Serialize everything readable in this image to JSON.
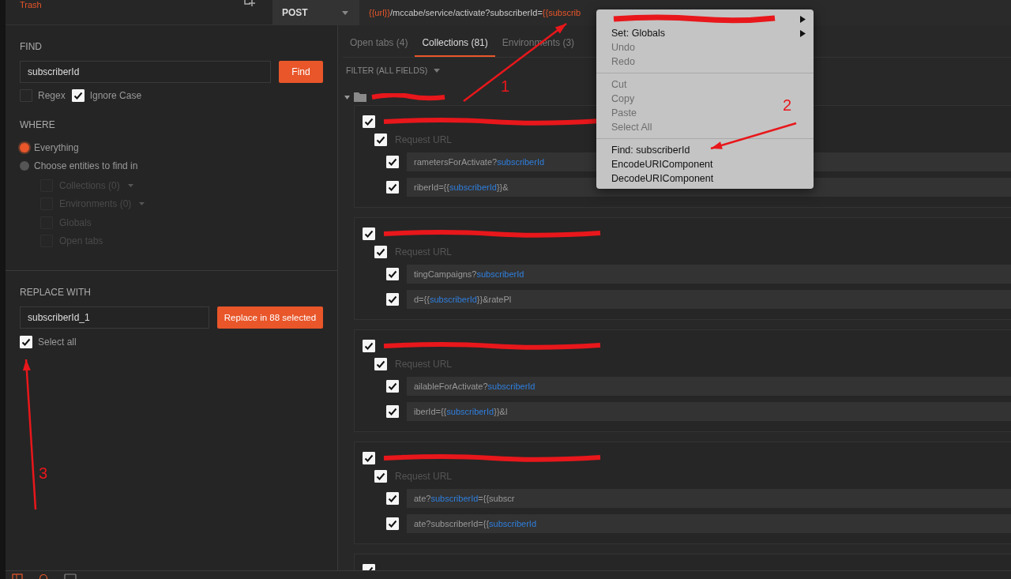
{
  "sidebar": {
    "title": "Trash"
  },
  "request": {
    "method": "POST",
    "url_parts": [
      {
        "text": "{{url}}",
        "variable": true
      },
      {
        "text": "/mccabe/service/activate?subscriberId=",
        "variable": false
      },
      {
        "text": "{{subscrib",
        "variable": true
      }
    ]
  },
  "find_panel": {
    "find_label": "FIND",
    "find_value": "subscriberId",
    "find_button": "Find",
    "options": [
      {
        "label": "Regex",
        "checked": false
      },
      {
        "label": "Ignore Case",
        "checked": true
      }
    ],
    "where_label": "WHERE",
    "scopes": [
      {
        "label": "Everything",
        "selected": true
      },
      {
        "label": "Choose entities to find in",
        "selected": false
      }
    ],
    "entities": [
      {
        "label": "Collections (0)",
        "checked": false,
        "dropdown": true
      },
      {
        "label": "Environments (0)",
        "checked": false,
        "dropdown": true
      },
      {
        "label": "Globals",
        "checked": false,
        "dropdown": false
      },
      {
        "label": "Open tabs",
        "checked": false,
        "dropdown": false
      }
    ],
    "replace_label": "REPLACE WITH",
    "replace_value": "subscriberId_1",
    "replace_button": "Replace in 88 selected",
    "select_all": {
      "label": "Select all",
      "checked": true
    }
  },
  "tabs": [
    {
      "label": "Open tabs (4)",
      "selected": false
    },
    {
      "label": "Collections (81)",
      "selected": true
    },
    {
      "label": "Environments (3)",
      "selected": false
    }
  ],
  "filter": {
    "label": "FILTER (ALL FIELDS)"
  },
  "results": [
    {
      "checked": true,
      "section": "Request URL",
      "section_checked": true,
      "urls": [
        {
          "checked": true,
          "parts": [
            {
              "text": "rametersForActivate?",
              "match": false
            },
            {
              "text": "subscriberId",
              "match": true
            }
          ]
        },
        {
          "checked": true,
          "parts": [
            {
              "text": "riberId={{",
              "match": false
            },
            {
              "text": "subscriberId",
              "match": true
            },
            {
              "text": "}}&",
              "match": false
            }
          ]
        }
      ]
    },
    {
      "checked": true,
      "section": "Request URL",
      "section_checked": true,
      "urls": [
        {
          "checked": true,
          "parts": [
            {
              "text": "tingCampaigns?",
              "match": false
            },
            {
              "text": "subscriberId",
              "match": true
            }
          ]
        },
        {
          "checked": true,
          "parts": [
            {
              "text": "d={{",
              "match": false
            },
            {
              "text": "subscriberId",
              "match": true
            },
            {
              "text": "}}&ratePl",
              "match": false
            }
          ]
        }
      ]
    },
    {
      "checked": true,
      "section": "Request URL",
      "section_checked": true,
      "urls": [
        {
          "checked": true,
          "parts": [
            {
              "text": "ailableForActivate?",
              "match": false
            },
            {
              "text": "subscriberId",
              "match": true
            }
          ]
        },
        {
          "checked": true,
          "parts": [
            {
              "text": "iberId={{",
              "match": false
            },
            {
              "text": "subscriberId",
              "match": true
            },
            {
              "text": "}}&l",
              "match": false
            }
          ]
        }
      ]
    },
    {
      "checked": true,
      "section": "Request URL",
      "section_checked": true,
      "urls": [
        {
          "checked": true,
          "parts": [
            {
              "text": "ate?",
              "match": false
            },
            {
              "text": "subscriberId",
              "match": true
            },
            {
              "text": "={{subscr",
              "match": false
            }
          ]
        },
        {
          "checked": true,
          "parts": [
            {
              "text": "ate?subscriberId={{",
              "match": false
            },
            {
              "text": "subscriberId",
              "match": true
            }
          ]
        }
      ]
    },
    {
      "checked": true
    }
  ],
  "context_menu": [
    {
      "kind": "redacted",
      "submenu": true
    },
    {
      "kind": "item",
      "label": "Set: Globals",
      "disabled": false,
      "submenu": true
    },
    {
      "kind": "item",
      "label": "Undo",
      "disabled": true,
      "submenu": false
    },
    {
      "kind": "item",
      "label": "Redo",
      "disabled": true,
      "submenu": false
    },
    {
      "kind": "separator"
    },
    {
      "kind": "item",
      "label": "Cut",
      "disabled": true,
      "submenu": false
    },
    {
      "kind": "item",
      "label": "Copy",
      "disabled": true,
      "submenu": false
    },
    {
      "kind": "item",
      "label": "Paste",
      "disabled": true,
      "submenu": false
    },
    {
      "kind": "item",
      "label": "Select All",
      "disabled": true,
      "submenu": false
    },
    {
      "kind": "separator"
    },
    {
      "kind": "item",
      "label": "Find: subscriberId",
      "disabled": false,
      "submenu": false
    },
    {
      "kind": "item",
      "label": "EncodeURIComponent",
      "disabled": false,
      "submenu": false
    },
    {
      "kind": "item",
      "label": "DecodeURIComponent",
      "disabled": false,
      "submenu": false
    }
  ],
  "annotations": [
    {
      "number": "1"
    },
    {
      "number": "2"
    },
    {
      "number": "3"
    }
  ]
}
